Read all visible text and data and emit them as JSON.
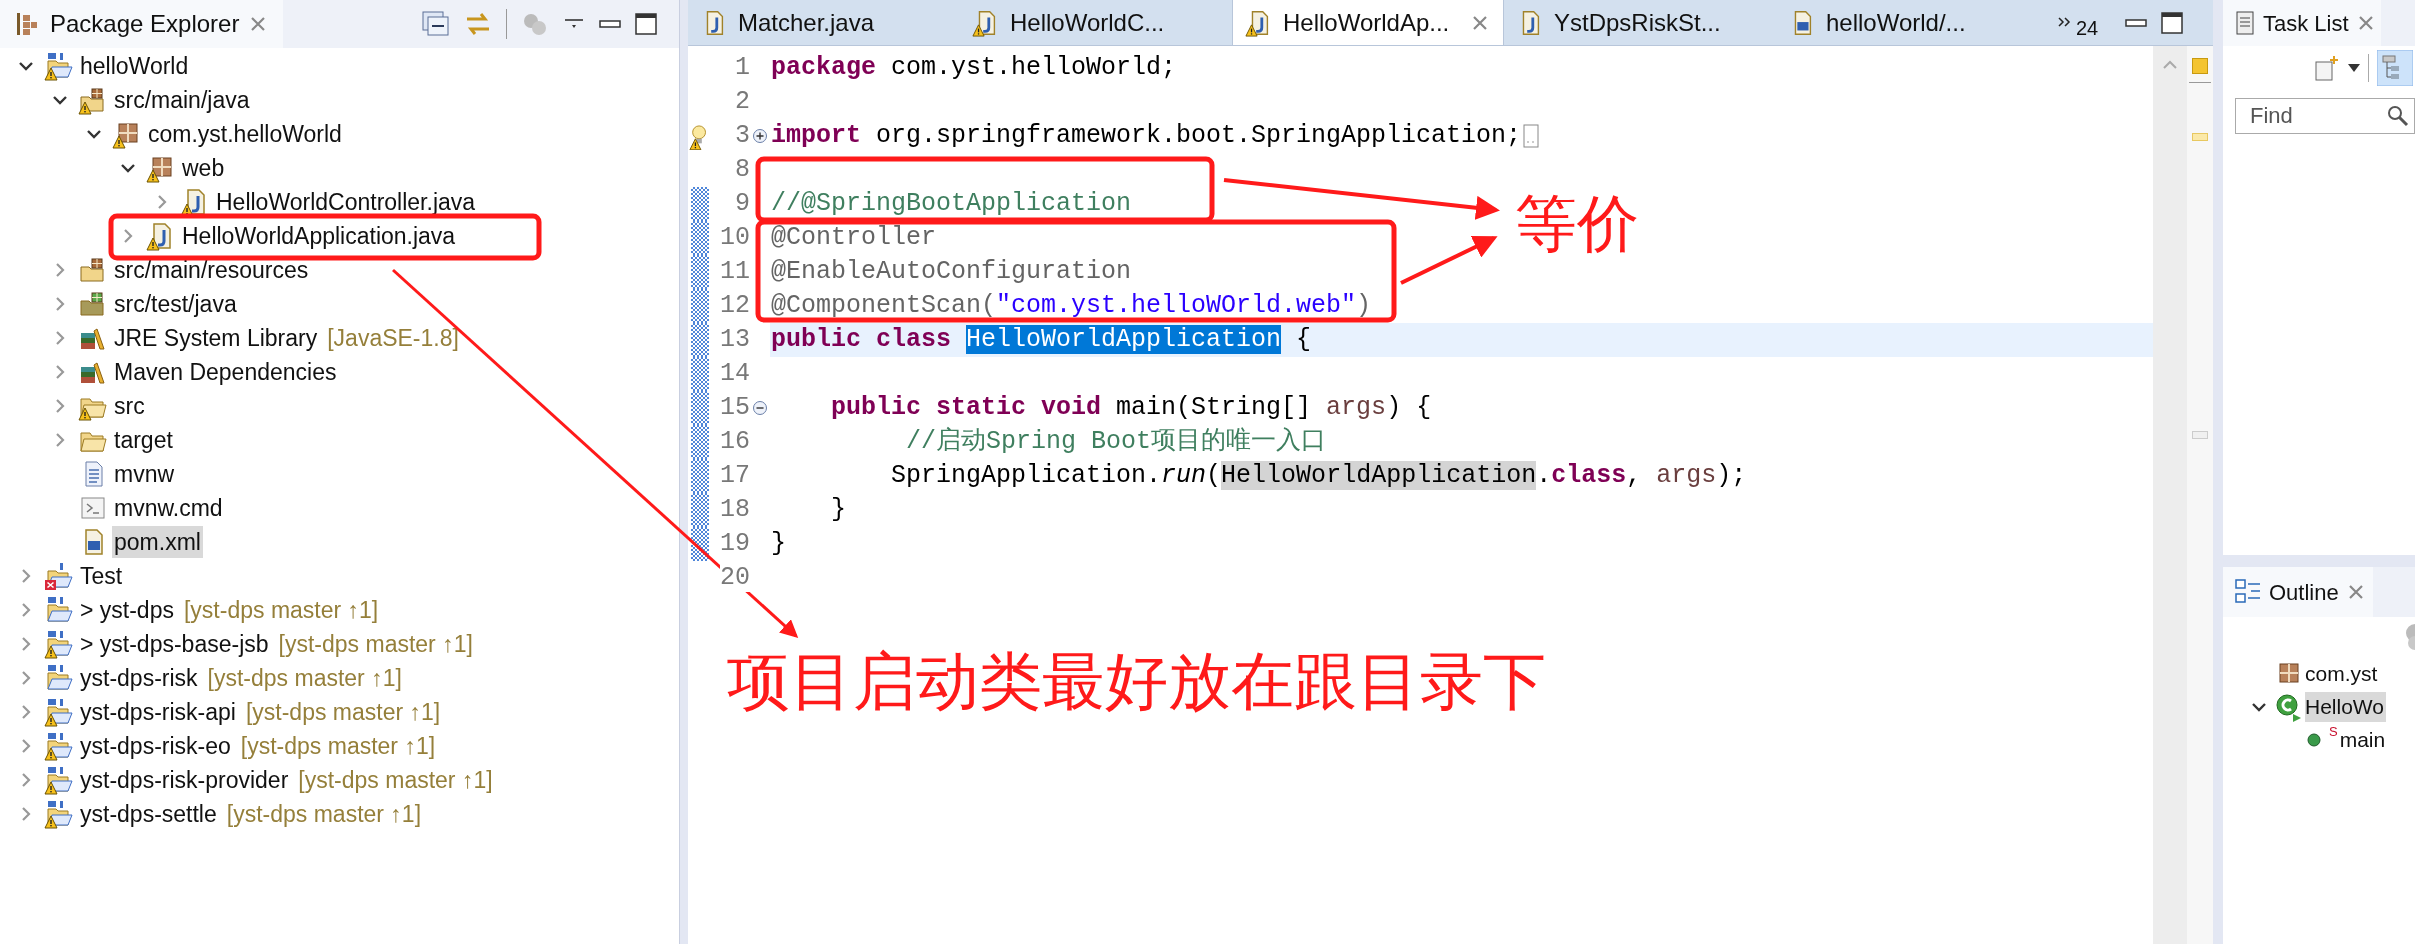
{
  "package_explorer": {
    "title": "Package Explorer",
    "tree": [
      {
        "label": "helloWorld",
        "kind": "maven-project",
        "warning": true,
        "expanded": true,
        "selected": false,
        "children": [
          {
            "label": "src/main/java",
            "kind": "source-folder",
            "warning": true,
            "expanded": true,
            "selected": false,
            "children": [
              {
                "label": "com.yst.helloWorld",
                "kind": "package",
                "warning": true,
                "expanded": true,
                "selected": false,
                "children": [
                  {
                    "label": "web",
                    "kind": "package",
                    "warning": true,
                    "expanded": true,
                    "selected": false,
                    "children": [
                      {
                        "label": "HelloWorldController.java",
                        "kind": "java-file",
                        "warning": true,
                        "expanded": false,
                        "selected": false
                      }
                    ]
                  },
                  {
                    "label": "HelloWorldApplication.java",
                    "kind": "java-file",
                    "warning": true,
                    "expanded": false,
                    "selected": false
                  }
                ]
              }
            ]
          },
          {
            "label": "src/main/resources",
            "kind": "source-folder",
            "warning": false,
            "expanded": false,
            "selected": false
          },
          {
            "label": "src/test/java",
            "kind": "test-folder",
            "warning": false,
            "expanded": false,
            "selected": false
          },
          {
            "label": "JRE System Library",
            "decoration": "[JavaSE-1.8]",
            "kind": "library",
            "warning": false,
            "expanded": false,
            "selected": false
          },
          {
            "label": "Maven Dependencies",
            "kind": "library",
            "warning": false,
            "expanded": false,
            "selected": false
          },
          {
            "label": "src",
            "kind": "folder",
            "warning": true,
            "expanded": false,
            "selected": false
          },
          {
            "label": "target",
            "kind": "folder",
            "warning": false,
            "expanded": false,
            "selected": false
          },
          {
            "label": "mvnw",
            "kind": "text-file",
            "warning": false,
            "selected": false
          },
          {
            "label": "mvnw.cmd",
            "kind": "script-file",
            "warning": false,
            "selected": false
          },
          {
            "label": "pom.xml",
            "kind": "maven-file",
            "warning": false,
            "selected": true
          }
        ]
      },
      {
        "label": "Test",
        "kind": "broken-project",
        "warning": false,
        "expanded": false,
        "selected": false
      },
      {
        "label": "> yst-dps",
        "decoration": "[yst-dps master ↑1]",
        "kind": "maven-project",
        "warning": false,
        "expanded": false,
        "selected": false
      },
      {
        "label": "> yst-dps-base-jsb",
        "decoration": "[yst-dps master ↑1]",
        "kind": "maven-project",
        "warning": true,
        "expanded": false,
        "selected": false
      },
      {
        "label": "yst-dps-risk",
        "decoration": "[yst-dps master ↑1]",
        "kind": "maven-project",
        "warning": false,
        "expanded": false,
        "selected": false
      },
      {
        "label": "yst-dps-risk-api",
        "decoration": "[yst-dps master ↑1]",
        "kind": "maven-project",
        "warning": true,
        "expanded": false,
        "selected": false
      },
      {
        "label": "yst-dps-risk-eo",
        "decoration": "[yst-dps master ↑1]",
        "kind": "maven-project",
        "warning": true,
        "expanded": false,
        "selected": false
      },
      {
        "label": "yst-dps-risk-provider",
        "decoration": "[yst-dps master ↑1]",
        "kind": "maven-project",
        "warning": true,
        "expanded": false,
        "selected": false
      },
      {
        "label": "yst-dps-settle",
        "decoration": "[yst-dps master ↑1]",
        "kind": "maven-project",
        "warning": true,
        "expanded": false,
        "selected": false
      }
    ]
  },
  "editor": {
    "tabs": [
      {
        "label": "Matcher.java",
        "kind": "java-file",
        "warning": false,
        "selected": false
      },
      {
        "label": "HelloWorldC...",
        "kind": "java-file",
        "warning": true,
        "selected": false
      },
      {
        "label": "HelloWorldAp...",
        "kind": "java-file",
        "warning": true,
        "selected": true
      },
      {
        "label": "YstDpsRiskSt...",
        "kind": "java-file",
        "warning": false,
        "selected": false
      },
      {
        "label": "helloWorld/...",
        "kind": "maven-file",
        "warning": false,
        "selected": false
      }
    ],
    "hidden_tab_count": "24",
    "lines": [
      {
        "number": "1",
        "changed": false,
        "current": false,
        "tokens": [
          {
            "kind": "kw",
            "t": "package"
          },
          {
            "kind": "plain",
            "t": " com.yst.helloWorld;"
          }
        ]
      },
      {
        "number": "2",
        "changed": false,
        "current": false
      },
      {
        "number": "3",
        "changed": false,
        "current": false,
        "bulb": true,
        "collapsed": true,
        "tokens": [
          {
            "kind": "kw",
            "t": "import"
          },
          {
            "kind": "plain",
            "t": " org.springframework.boot.SpringApplication;"
          }
        ]
      },
      {
        "number": "8",
        "changed": false,
        "current": false
      },
      {
        "number": "9",
        "changed": true,
        "current": false,
        "tokens": [
          {
            "kind": "comment",
            "t": "//@SpringBootApplication"
          }
        ]
      },
      {
        "number": "10",
        "changed": true,
        "current": false,
        "tokens": [
          {
            "kind": "annotation",
            "t": "@Controller"
          }
        ]
      },
      {
        "number": "11",
        "changed": true,
        "current": false,
        "tokens": [
          {
            "kind": "annotation",
            "t": "@EnableAutoConfiguration"
          }
        ]
      },
      {
        "number": "12",
        "changed": true,
        "current": false,
        "tokens": [
          {
            "kind": "annotation",
            "t": "@ComponentScan("
          },
          {
            "kind": "string",
            "t": "\"com.yst.helloWOrld.web\""
          },
          {
            "kind": "annotation",
            "t": ")"
          }
        ]
      },
      {
        "number": "13",
        "changed": true,
        "current": true,
        "tokens": [
          {
            "kind": "kw",
            "t": "public class "
          },
          {
            "kind": "selection",
            "t": "HelloWorldApplication"
          },
          {
            "kind": "plain",
            "t": " {"
          }
        ]
      },
      {
        "number": "14",
        "changed": true,
        "current": false
      },
      {
        "number": "15",
        "changed": true,
        "current": false,
        "collapsed": false,
        "tokens": [
          {
            "kind": "kw",
            "t": "    public static void"
          },
          {
            "kind": "plain",
            "t": " main(String[] "
          },
          {
            "kind": "param",
            "t": "args"
          },
          {
            "kind": "plain",
            "t": ") {"
          }
        ]
      },
      {
        "number": "16",
        "changed": true,
        "current": false,
        "tokens": [
          {
            "kind": "comment",
            "t": "         //启动Spring Boot项目的唯一入口"
          }
        ]
      },
      {
        "number": "17",
        "changed": true,
        "current": false,
        "tokens": [
          {
            "kind": "plain",
            "t": "        SpringApplication."
          },
          {
            "kind": "italic",
            "t": "run"
          },
          {
            "kind": "plain",
            "t": "("
          },
          {
            "kind": "occurrence",
            "t": "HelloWorldApplication"
          },
          {
            "kind": "plain",
            "t": "."
          },
          {
            "kind": "kw",
            "t": "class"
          },
          {
            "kind": "plain",
            "t": ", "
          },
          {
            "kind": "param",
            "t": "args"
          },
          {
            "kind": "plain",
            "t": ");"
          }
        ]
      },
      {
        "number": "18",
        "changed": true,
        "current": false,
        "tokens": [
          {
            "kind": "plain",
            "t": "    }"
          }
        ]
      },
      {
        "number": "19",
        "changed": true,
        "current": false,
        "tokens": [
          {
            "kind": "plain",
            "t": "}"
          }
        ]
      },
      {
        "number": "20",
        "changed": false,
        "current": false
      }
    ]
  },
  "task_list": {
    "title": "Task List",
    "find_placeholder": "Find"
  },
  "outline": {
    "title": "Outline",
    "tree": [
      {
        "label": "com.yst",
        "kind": "package",
        "selected": false
      },
      {
        "label": "HelloWo",
        "kind": "class",
        "expanded": true,
        "selected": true,
        "children": [
          {
            "label": "main",
            "kind": "method",
            "static_mark": "S",
            "selected": false
          }
        ]
      }
    ]
  },
  "annotations": {
    "notes": [
      "等价",
      "项目启动类最好放在跟目录下"
    ]
  }
}
